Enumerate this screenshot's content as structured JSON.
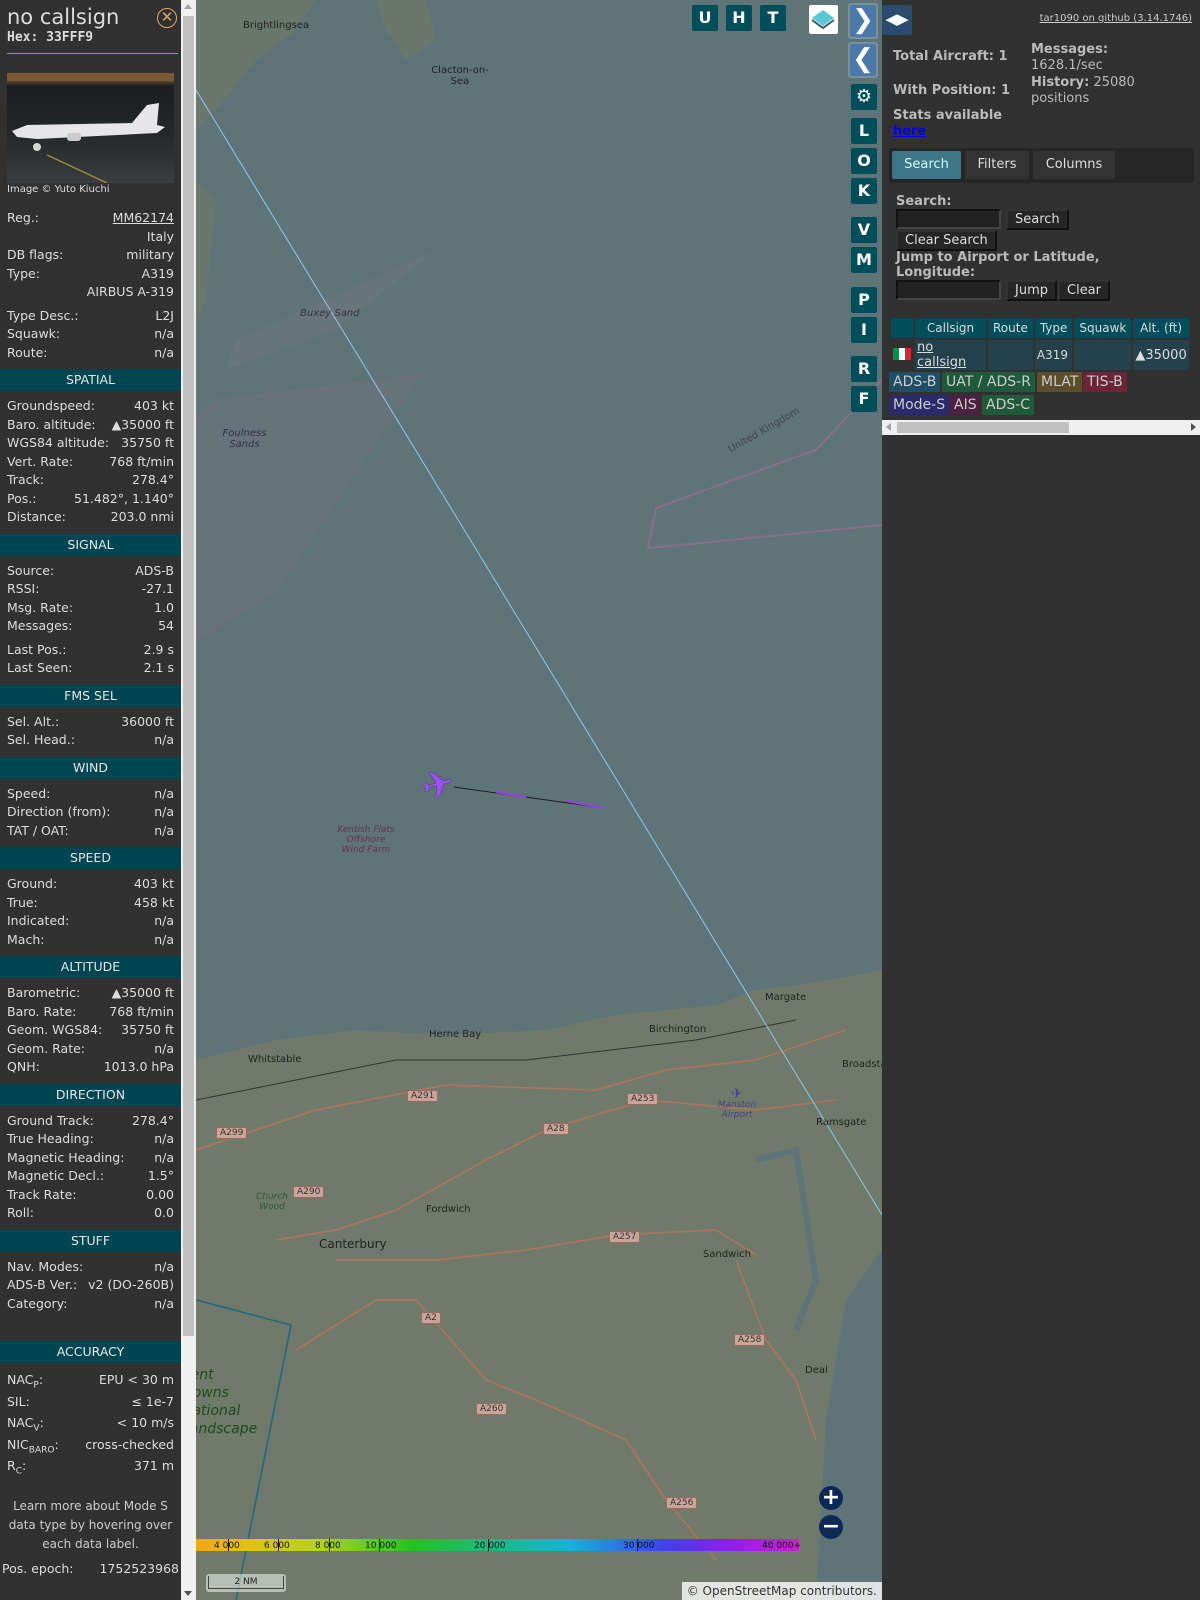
{
  "sidebar": {
    "callsign": "no callsign",
    "hex": "Hex:  33FFF9",
    "photo_credit": "Image © Yuto Kiuchi",
    "details": [
      {
        "label": "Reg.:",
        "value": "MM62174",
        "link": true
      },
      {
        "label": "",
        "value": "Italy"
      },
      {
        "label": "DB flags:",
        "value": "military"
      },
      {
        "label": "Type:",
        "value": "A319"
      },
      {
        "label": "",
        "value": "AIRBUS A-319",
        "gap_after": true
      },
      {
        "label": "Type Desc.:",
        "value": "L2J"
      },
      {
        "label": "Squawk:",
        "value": "n/a"
      },
      {
        "label": "Route:",
        "value": "n/a"
      }
    ],
    "sections": [
      {
        "title": "SPATIAL",
        "rows": [
          {
            "label": "Groundspeed:",
            "value": "403 kt"
          },
          {
            "label": "Baro. altitude:",
            "value": "▲35000 ft"
          },
          {
            "label": "WGS84 altitude:",
            "value": "35750 ft"
          },
          {
            "label": "Vert. Rate:",
            "value": "768 ft/min"
          },
          {
            "label": "Track:",
            "value": "278.4°"
          },
          {
            "label": "Pos.:",
            "value": "51.482°, 1.140°"
          },
          {
            "label": "Distance:",
            "value": "203.0 nmi"
          }
        ]
      },
      {
        "title": "SIGNAL",
        "rows": [
          {
            "label": "Source:",
            "value": "ADS-B"
          },
          {
            "label": "RSSI:",
            "value": "-27.1"
          },
          {
            "label": "Msg. Rate:",
            "value": "1.0"
          },
          {
            "label": "Messages:",
            "value": "54",
            "gap_after": true
          },
          {
            "label": "Last Pos.:",
            "value": "2.9 s"
          },
          {
            "label": "Last Seen:",
            "value": "2.1 s"
          }
        ]
      },
      {
        "title": "FMS SEL",
        "rows": [
          {
            "label": "Sel. Alt.:",
            "value": "36000 ft"
          },
          {
            "label": "Sel. Head.:",
            "value": "n/a"
          }
        ]
      },
      {
        "title": "WIND",
        "rows": [
          {
            "label": "Speed:",
            "value": "n/a"
          },
          {
            "label": "Direction (from):",
            "value": "n/a"
          },
          {
            "label": "TAT / OAT:",
            "value": "n/a"
          }
        ]
      },
      {
        "title": "SPEED",
        "rows": [
          {
            "label": "Ground:",
            "value": "403 kt"
          },
          {
            "label": "True:",
            "value": "458 kt"
          },
          {
            "label": "Indicated:",
            "value": "n/a"
          },
          {
            "label": "Mach:",
            "value": "n/a"
          }
        ]
      },
      {
        "title": "ALTITUDE",
        "rows": [
          {
            "label": "Barometric:",
            "value": "▲35000 ft"
          },
          {
            "label": "Baro. Rate:",
            "value": "768 ft/min"
          },
          {
            "label": "Geom. WGS84:",
            "value": "35750 ft"
          },
          {
            "label": "Geom. Rate:",
            "value": "n/a"
          },
          {
            "label": "QNH:",
            "value": "1013.0 hPa"
          }
        ]
      },
      {
        "title": "DIRECTION",
        "rows": [
          {
            "label": "Ground Track:",
            "value": "278.4°"
          },
          {
            "label": "True Heading:",
            "value": "n/a"
          },
          {
            "label": "Magnetic Heading:",
            "value": "n/a"
          },
          {
            "label": "Magnetic Decl.:",
            "value": "1.5°"
          },
          {
            "label": "Track Rate:",
            "value": "0.00"
          },
          {
            "label": "Roll:",
            "value": "0.0"
          }
        ]
      },
      {
        "title": "STUFF",
        "rows": [
          {
            "label": "Nav. Modes:",
            "value": "n/a"
          },
          {
            "label": "ADS-B Ver.:",
            "value": "v2 (DO-260B)"
          },
          {
            "label": "Category:",
            "value": "n/a",
            "big_gap_after": true
          }
        ]
      },
      {
        "title": "ACCURACY",
        "tall": true,
        "rows": [
          {
            "label": "NAC",
            "sub": "P",
            "value": "EPU < 30 m"
          },
          {
            "label": "SIL",
            "sub": "",
            "value": "≤ 1e-7"
          },
          {
            "label": "NAC",
            "sub": "V",
            "value": "< 10 m/s"
          },
          {
            "label": "NIC",
            "sub": "BARO",
            "value": "cross-checked"
          },
          {
            "label": "R",
            "sub": "C",
            "value": "371 m"
          }
        ]
      }
    ],
    "note": "Learn more about Mode S data type by hovering over each data label.",
    "pos_epoch_label": "Pos. epoch:",
    "pos_epoch": "1752523968"
  },
  "map": {
    "top_buttons": [
      "U",
      "H",
      "T"
    ],
    "side_buttons": [
      "L",
      "O",
      "K",
      "V",
      "M",
      "P",
      "I",
      "R",
      "F"
    ],
    "places": [
      "Brightlingsea",
      "Clacton-on-Sea",
      "Buxey Sand",
      "Foulness Sands",
      "United Kingdom",
      "Kentish Flats Offshore Wind Farm",
      "Margate",
      "Birchington",
      "Herne Bay",
      "Whitstable",
      "Broadstairs",
      "Manston Airport",
      "Ramsgate",
      "Fordwich",
      "Canterbury",
      "Church Wood",
      "Sandwich",
      "Deal",
      "Kent Downs National Landscape"
    ],
    "roads": [
      "A291",
      "A253",
      "A28",
      "A299",
      "A290",
      "A257",
      "A2",
      "A258",
      "A260",
      "A256"
    ],
    "altitude_ticks": [
      "4 000",
      "6 000",
      "8 000",
      "10 000",
      "20 000",
      "30 000",
      "40 000+"
    ],
    "scale": "2 NM",
    "attribution_prefix": "© ",
    "attribution_link": "OpenStreetMap",
    "attribution_suffix": " contributors."
  },
  "right": {
    "github": "tar1090 on github (3.14.1746)",
    "total_aircraft": "Total Aircraft: 1",
    "with_position": "With Position: 1",
    "messages_label": "Messages:",
    "messages_value": "1628.1/sec",
    "history_label": "History:",
    "history_value": "25080 positions",
    "stats_label": "Stats available",
    "stats_link": "here",
    "tabs": [
      "Search",
      "Filters",
      "Columns"
    ],
    "search_label": "Search:",
    "search_value": "",
    "search_button": "Search",
    "clear_search_button": "Clear Search",
    "jump_label": "Jump to Airport or Latitude, Longitude:",
    "jump_value": "",
    "jump_button": "Jump",
    "clear_button": "Clear",
    "table": {
      "headers": [
        "Callsign",
        "Route",
        "Type",
        "Squawk",
        "Alt. (ft)"
      ],
      "rows": [
        {
          "callsign": "no callsign",
          "route": "",
          "type": "A319",
          "squawk": "",
          "alt": "▲35000"
        }
      ]
    },
    "legend": [
      {
        "label": "ADS-B",
        "color": "#1e4f66"
      },
      {
        "label": "UAT / ADS-R",
        "color": "#1f5a3a"
      },
      {
        "label": "MLAT",
        "color": "#5b4e2a"
      },
      {
        "label": "TIS-B",
        "color": "#6b2438"
      },
      {
        "label": "Mode-S",
        "color": "#2b2a6a"
      },
      {
        "label": "AIS",
        "color": "#4a2140"
      },
      {
        "label": "ADS-C",
        "color": "#1f5a3a"
      }
    ]
  }
}
